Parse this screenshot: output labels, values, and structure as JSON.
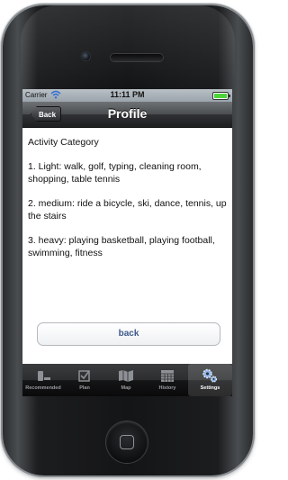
{
  "status_bar": {
    "carrier": "Carrier",
    "time": "11:11 PM",
    "wifi_icon": "wifi-icon",
    "battery_icon": "battery-icon",
    "battery_color": "#4cd33a"
  },
  "nav_bar": {
    "back_label": "Back",
    "title": "Profile"
  },
  "content": {
    "heading": "Activity Category",
    "items": [
      "1. Light: walk, golf, typing, cleaning room, shopping, table tennis",
      "2. medium: ride a bicycle, ski, dance, tennis, up the stairs",
      "3. heavy: playing basketball, playing football, swimming, fitness"
    ]
  },
  "back_button_label": "back",
  "tab_bar": {
    "tabs": [
      {
        "label": "Recommended",
        "icon": "scale-icon"
      },
      {
        "label": "Plan",
        "icon": "checklist-icon"
      },
      {
        "label": "Map",
        "icon": "map-icon"
      },
      {
        "label": "History",
        "icon": "calendar-icon"
      },
      {
        "label": "Settings",
        "icon": "gears-icon",
        "active": true
      }
    ]
  }
}
